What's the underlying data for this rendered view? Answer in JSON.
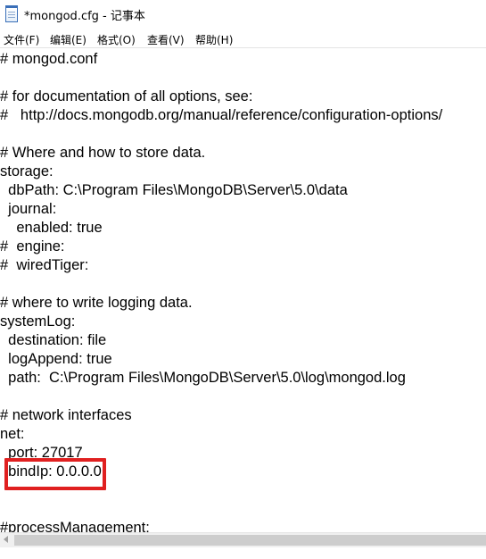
{
  "window": {
    "title": "*mongod.cfg - 记事本",
    "icon": "notepad-icon"
  },
  "menubar": {
    "items": [
      {
        "label": "文件(F)"
      },
      {
        "label": "编辑(E)"
      },
      {
        "label": "格式(O)"
      },
      {
        "label": "查看(V)"
      },
      {
        "label": "帮助(H)"
      }
    ]
  },
  "editor": {
    "lines": [
      "# mongod.conf",
      "",
      "# for documentation of all options, see:",
      "#   http://docs.mongodb.org/manual/reference/configuration-options/",
      "",
      "# Where and how to store data.",
      "storage:",
      "  dbPath: C:\\Program Files\\MongoDB\\Server\\5.0\\data",
      "  journal:",
      "    enabled: true",
      "#  engine:",
      "#  wiredTiger:",
      "",
      "# where to write logging data.",
      "systemLog:",
      "  destination: file",
      "  logAppend: true",
      "  path:  C:\\Program Files\\MongoDB\\Server\\5.0\\log\\mongod.log",
      "",
      "# network interfaces",
      "net:",
      "  port: 27017",
      "  bindIp: 0.0.0.0",
      "",
      "",
      "#processManagement:"
    ],
    "highlight_color": "#e02020"
  }
}
